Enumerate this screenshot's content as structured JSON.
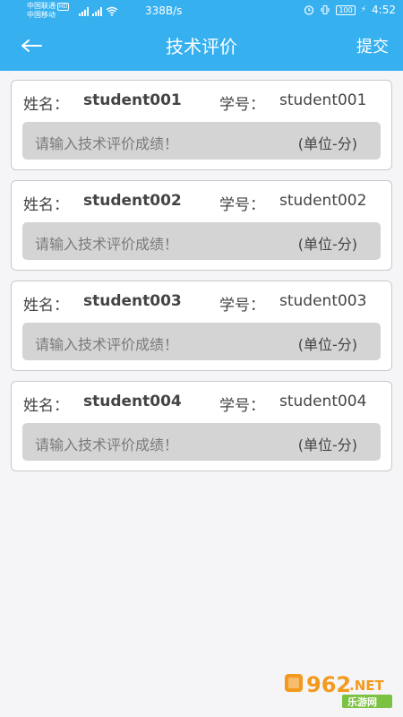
{
  "status_bar": {
    "carrier1": "中国联通",
    "carrier1_badge": "HD",
    "carrier2": "中国移动",
    "net_speed": "338B/s",
    "battery": "100",
    "time": "4:52",
    "icons": [
      "signal-icon",
      "wifi-icon",
      "alarm-icon",
      "vibrate-icon",
      "battery-icon",
      "charging-icon"
    ]
  },
  "nav": {
    "back_icon": "back-arrow-icon",
    "title": "技术评价",
    "submit_label": "提交"
  },
  "students": [
    {
      "name_label": "姓名：",
      "name": "student001",
      "id_label": "学号：",
      "id": "student001",
      "placeholder": "请输入技术评价成绩！",
      "unit": "(单位-分)"
    },
    {
      "name_label": "姓名：",
      "name": "student002",
      "id_label": "学号：",
      "id": "student002",
      "placeholder": "请输入技术评价成绩！",
      "unit": "(单位-分)"
    },
    {
      "name_label": "姓名：",
      "name": "student003",
      "id_label": "学号：",
      "id": "student003",
      "placeholder": "请输入技术评价成绩！",
      "unit": "(单位-分)"
    },
    {
      "name_label": "姓名：",
      "name": "student004",
      "id_label": "学号：",
      "id": "student004",
      "placeholder": "请输入技术评价成绩！",
      "unit": "(单位-分)"
    }
  ],
  "watermark": {
    "number": "962",
    "suffix": ".NET",
    "caption": "乐游网"
  },
  "colors": {
    "header": "#36b0ef",
    "card_border": "#c9c9cc",
    "input_bg": "#d4d4d4",
    "page_bg": "#f5f5f7",
    "watermark_orange": "#f39a1e",
    "watermark_green": "#7cc242"
  }
}
